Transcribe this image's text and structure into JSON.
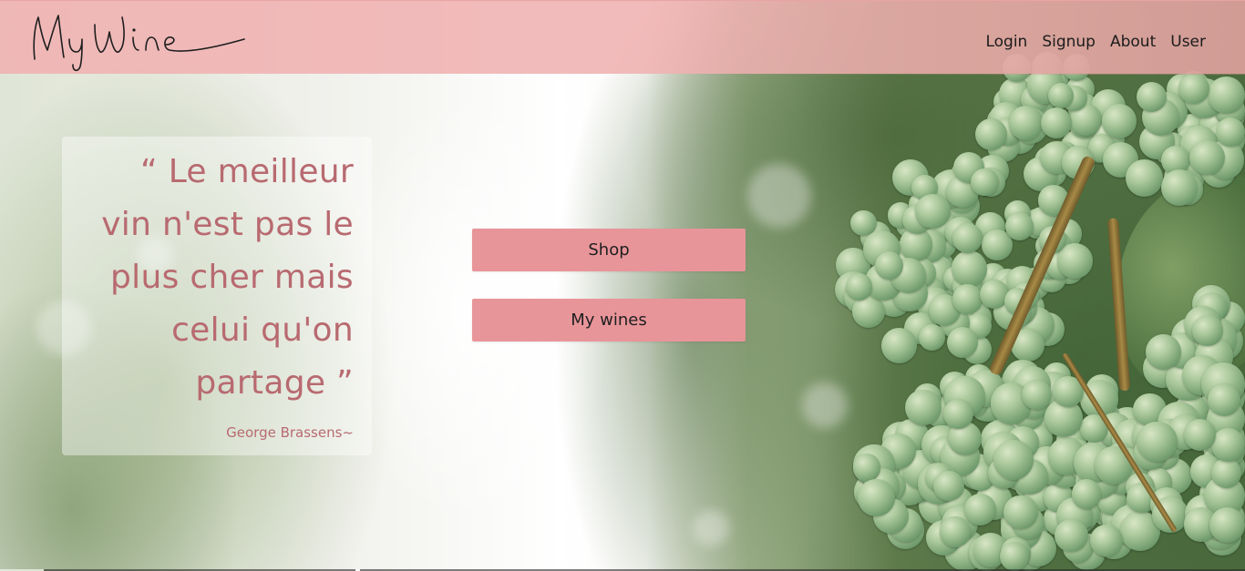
{
  "brand": {
    "logo_text": "MyWine"
  },
  "nav": {
    "login": "Login",
    "signup": "Signup",
    "about": "About",
    "user": "User"
  },
  "quote": {
    "text": "“ Le meilleur vin n'est pas le plus cher mais celui qu'on partage ”",
    "author": "George Brassens~"
  },
  "actions": {
    "shop": "Shop",
    "my_wines": "My wines"
  },
  "colors": {
    "header": "#f0b2b2",
    "accent_button": "#e8959a",
    "quote_text": "#b86a70"
  }
}
